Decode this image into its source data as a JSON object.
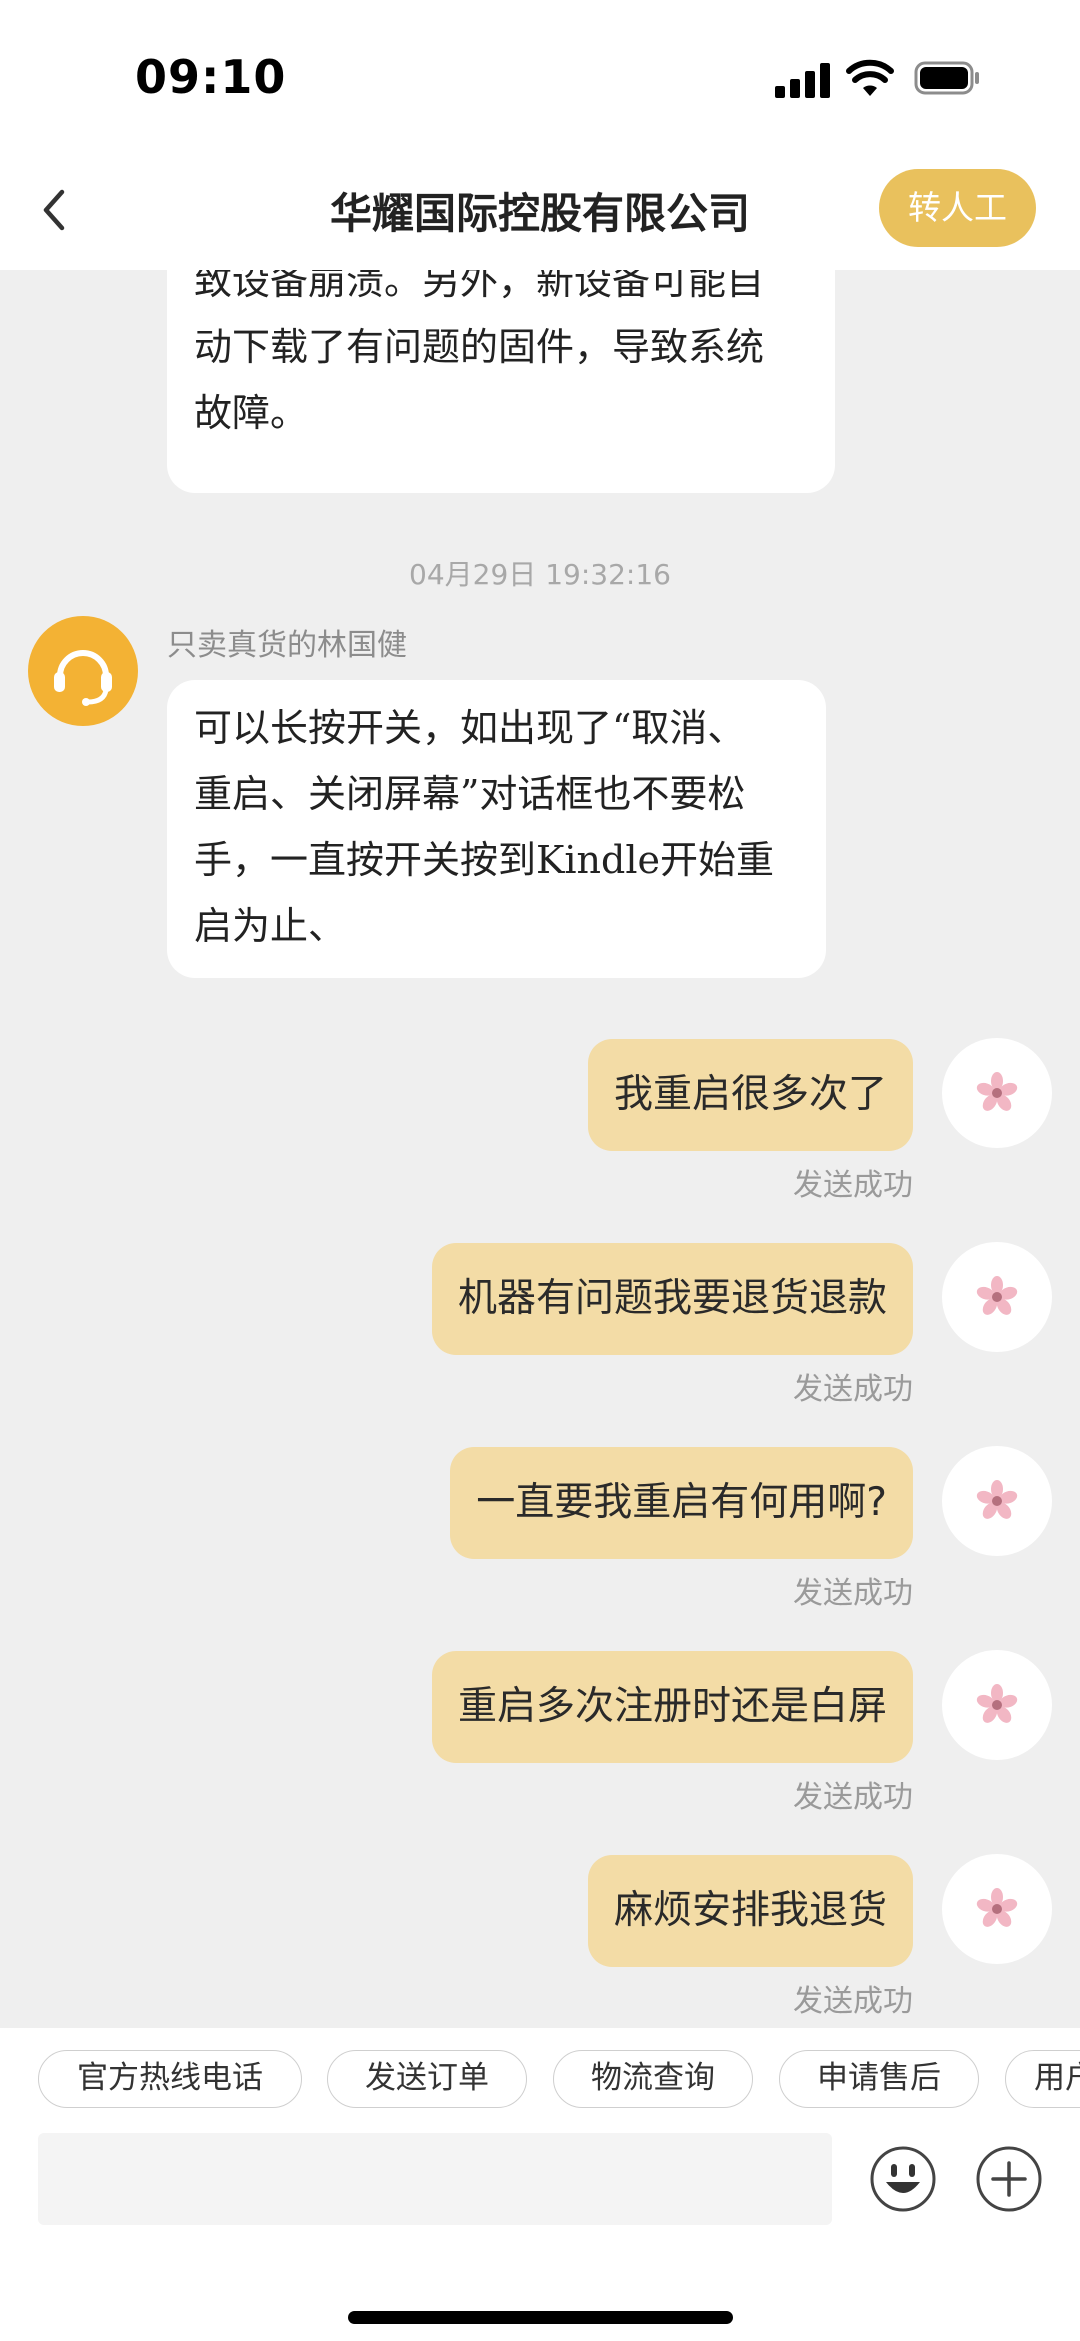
{
  "status_bar": {
    "time": "09:10"
  },
  "header": {
    "title": "华耀国际控股有限公司",
    "transfer_label": "转人工"
  },
  "chat": {
    "partial_message": [
      "致设备崩溃。另外，新设备可能自",
      "动下载了有问题的固件，导致系统",
      "故障。"
    ],
    "timestamp": "04月29日 19:32:16",
    "agent_name": "只卖真货的林国健",
    "agent_message": [
      "可以长按开关，如出现了“取消、",
      "重启、关闭屏幕”对话框也不要松",
      "手，一直按开关按到Kindle开始重",
      "启为止、"
    ],
    "user_messages": [
      {
        "text": "我重启很多次了",
        "status": "发送成功"
      },
      {
        "text": "机器有问题我要退货退款",
        "status": "发送成功"
      },
      {
        "text": "一直要我重启有何用啊?",
        "status": "发送成功"
      },
      {
        "text": "重启多次注册时还是白屏",
        "status": "发送成功"
      },
      {
        "text": "麻烦安排我退货",
        "status": "发送成功"
      }
    ]
  },
  "quick_replies": [
    "官方热线电话",
    "发送订单",
    "物流查询",
    "申请售后",
    "用户"
  ],
  "input": {
    "value": "",
    "placeholder": ""
  },
  "colors": {
    "accent": "#e9c15d",
    "outgoing_bubble": "#f3dca6",
    "agent_avatar": "#f3b234",
    "chat_bg": "#efefef"
  },
  "icons": {
    "back": "chevron-left-icon",
    "agent": "headset-icon",
    "user": "flower-icon",
    "emoji": "smiley-icon",
    "plus": "plus-icon"
  }
}
